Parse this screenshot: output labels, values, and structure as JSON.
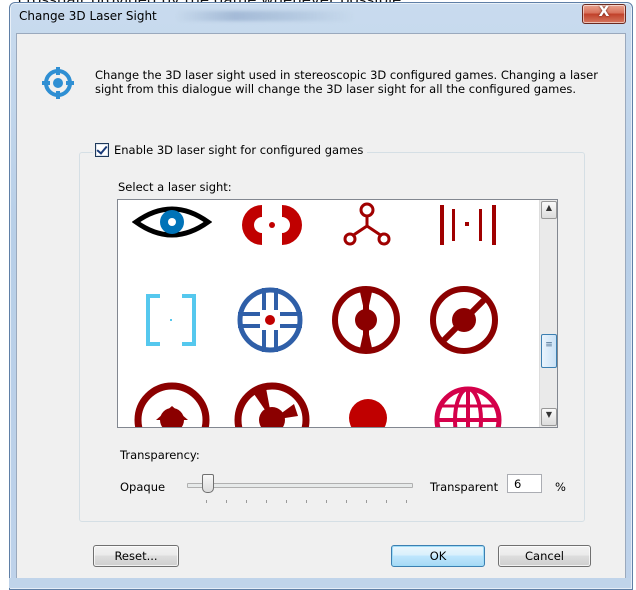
{
  "background_caption": "crosshair provided by the game whenever possible.",
  "window": {
    "title": "Change 3D Laser Sight",
    "close_label": "X"
  },
  "info_text": "Change the 3D laser sight used in stereoscopic 3D configured games. Changing a laser sight from this dialogue will change the 3D laser sight for all the configured games.",
  "enable_checkbox": {
    "label": "Enable 3D laser sight for configured games",
    "checked": true
  },
  "laser_list": {
    "label": "Select a laser sight:",
    "items": [
      {
        "icon": "eye-sight-icon",
        "color": "#0073b8"
      },
      {
        "icon": "split-ring-sight-icon",
        "color": "#c00000"
      },
      {
        "icon": "tripod-sight-icon",
        "color": "#a00000"
      },
      {
        "icon": "bars-sight-icon",
        "color": "#a00000"
      },
      {
        "icon": "brackets-sight-icon",
        "color": "#55c8ee"
      },
      {
        "icon": "blue-crosshair-sight-icon",
        "color": "#2f5fa8"
      },
      {
        "icon": "circle-dot-vertical-sight-icon",
        "color": "#8b0000"
      },
      {
        "icon": "circle-dot-diagonal-sight-icon",
        "color": "#8b0000"
      },
      {
        "icon": "circle-triangle-sight-icon",
        "color": "#8b0000"
      },
      {
        "icon": "circle-wedge-sight-icon",
        "color": "#8b0000"
      },
      {
        "icon": "dot-sight-icon",
        "color": "#c00000"
      },
      {
        "icon": "globe-sight-icon",
        "color": "#d4004a"
      }
    ]
  },
  "transparency": {
    "label": "Transparency:",
    "min_label": "Opaque",
    "max_label": "Transparent",
    "value": "6",
    "unit": "%"
  },
  "buttons": {
    "reset": "Reset...",
    "ok": "OK",
    "cancel": "Cancel"
  }
}
